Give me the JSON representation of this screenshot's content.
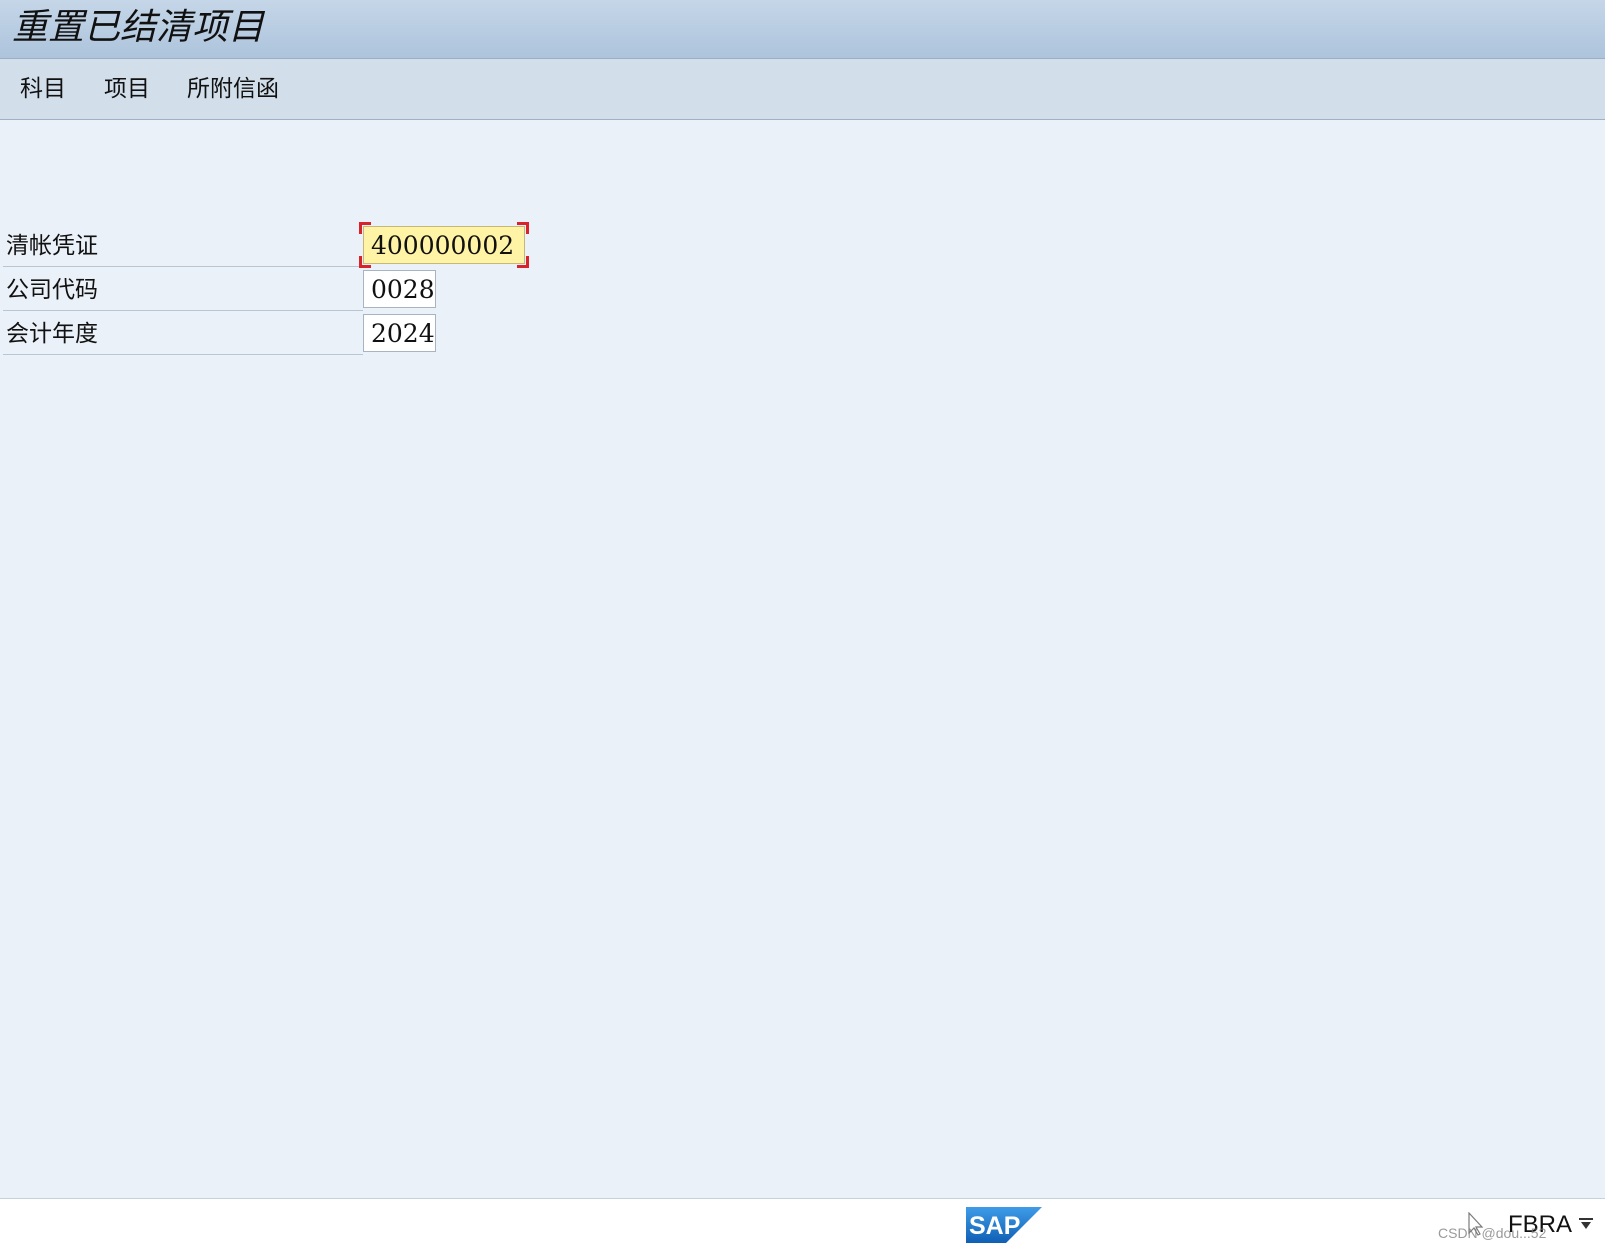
{
  "header": {
    "title": "重置已结清项目"
  },
  "menu": {
    "items": [
      {
        "label": "科目"
      },
      {
        "label": "项目"
      },
      {
        "label": "所附信函"
      }
    ]
  },
  "form": {
    "fields": [
      {
        "label": "清帐凭证",
        "value": "400000002",
        "focused": true
      },
      {
        "label": "公司代码",
        "value": "0028"
      },
      {
        "label": "会计年度",
        "value": "2024"
      }
    ]
  },
  "status": {
    "logo_text": "SAP",
    "transaction": "FBRA",
    "watermark": "CSDN @dou...52"
  },
  "colors": {
    "focused_field_bg": "#fff4a6",
    "focus_corner": "#d8232a",
    "sap_blue": "#1b6fc6",
    "background": "#eaf1f8"
  },
  "icons": {
    "status_pointer": "pointer-icon",
    "transaction_dropdown": "dropdown-icon"
  }
}
